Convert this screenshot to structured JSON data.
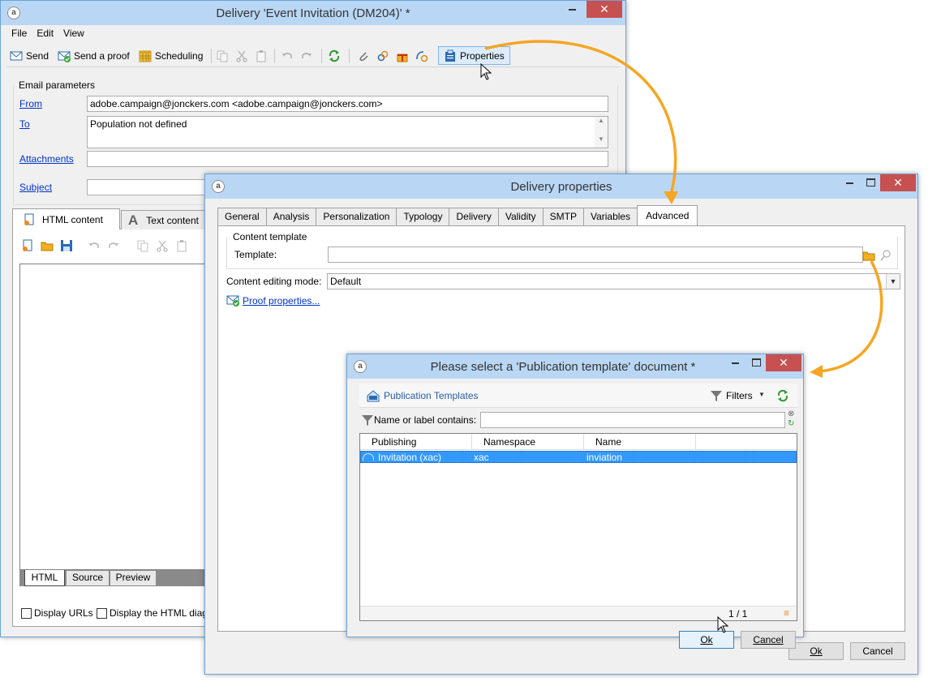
{
  "delivery_window": {
    "title": "Delivery 'Event Invitation (DM204)' *",
    "menu": [
      "File",
      "Edit",
      "View"
    ],
    "toolbar": {
      "send": "Send",
      "send_proof": "Send a proof",
      "scheduling": "Scheduling",
      "properties": "Properties"
    },
    "email_params": {
      "group_label": "Email parameters",
      "from_label": "From",
      "from_value": "adobe.campaign@jonckers.com <adobe.campaign@jonckers.com>",
      "to_label": "To",
      "to_value": "Population not defined",
      "attachments_label": "Attachments",
      "subject_label": "Subject"
    },
    "content_tabs": {
      "html": "HTML content",
      "text": "Text content"
    },
    "bottom_tabs": [
      "HTML",
      "Source",
      "Preview"
    ],
    "checkboxes": {
      "display_urls": "Display URLs",
      "display_html": "Display the HTML diag"
    }
  },
  "properties_window": {
    "title": "Delivery properties",
    "tabs": [
      "General",
      "Analysis",
      "Personalization",
      "Typology",
      "Delivery",
      "Validity",
      "SMTP",
      "Variables",
      "Advanced"
    ],
    "active_tab": "Advanced",
    "content_template_group": "Content template",
    "template_label": "Template:",
    "template_value": "",
    "editing_mode_label": "Content editing mode:",
    "editing_mode_value": "Default",
    "proof_link": "Proof properties...",
    "ok": "Ok",
    "cancel": "Cancel"
  },
  "select_window": {
    "title": "Please select a 'Publication template' document *",
    "list_title": "Publication Templates",
    "filters": "Filters",
    "search_label": "Name or label contains:",
    "search_value": "",
    "columns": [
      "Publishing",
      "Namespace",
      "Name"
    ],
    "rows": [
      {
        "publishing": "Invitation (xac)",
        "namespace": "xac",
        "name": "inviation"
      }
    ],
    "pagination": "1 / 1",
    "ok": "Ok",
    "cancel": "Cancel"
  },
  "colors": {
    "accent_arrow": "#f5a623",
    "selection": "#3399ff",
    "titlebar": "#b9d7f4",
    "close_button": "#c75050",
    "link": "#0033cc"
  }
}
